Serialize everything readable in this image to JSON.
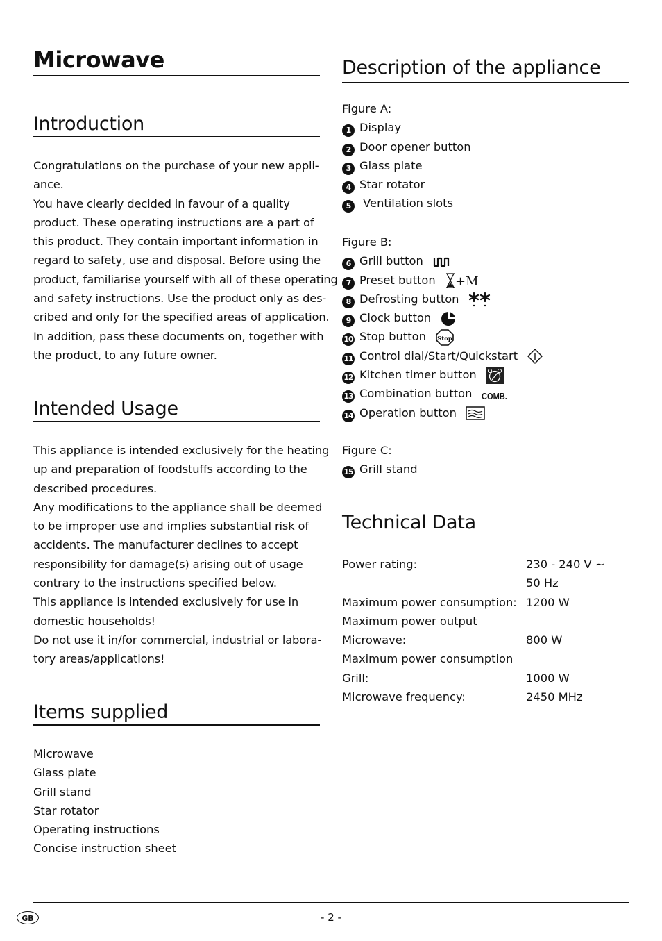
{
  "title": "Microwave",
  "introduction": {
    "heading": "Introduction",
    "lines": [
      "Congratulations on the purchase of your new appli-",
      "ance.",
      "You have clearly decided in favour of a quality",
      "product. These operating instructions are a part of",
      "this product. They contain important information in",
      "regard to safety, use and disposal. Before using the",
      "product, familiarise yourself with all of these operating",
      "and safety instructions. Use the product only as des-",
      "cribed and only for the specified areas of application.",
      "In addition, pass these documents on, together with",
      "the product, to any future owner."
    ]
  },
  "intended_usage": {
    "heading": "Intended Usage",
    "lines": [
      "This appliance is intended exclusively for the heating",
      "up and preparation of foodstuffs according to the",
      "described procedures.",
      "Any modifications to the appliance shall be deemed",
      "to be improper use and implies substantial risk of",
      "accidents. The manufacturer declines to accept",
      "responsibility for damage(s) arising out of usage",
      "contrary to the instructions specified below.",
      "This appliance is intended exclusively for use in",
      "domestic households!",
      "Do not use it in/for commercial, industrial or labora-",
      "tory areas/applications!"
    ]
  },
  "items_supplied": {
    "heading": "Items supplied",
    "items": [
      "Microwave",
      "Glass plate",
      "Grill stand",
      "Star rotator",
      "Operating instructions",
      "Concise instruction sheet"
    ]
  },
  "description": {
    "heading": "Description of the appliance",
    "figure_a": {
      "label": "Figure A:",
      "items": [
        {
          "num": "1",
          "text": "Display"
        },
        {
          "num": "2",
          "text": "Door opener button"
        },
        {
          "num": "3",
          "text": "Glass plate"
        },
        {
          "num": "4",
          "text": "Star rotator"
        },
        {
          "num": "5",
          "text": " Ventilation slots"
        }
      ]
    },
    "figure_b": {
      "label": "Figure B:",
      "items": [
        {
          "num": "6",
          "text": "Grill button",
          "icon": "grill-icon"
        },
        {
          "num": "7",
          "text": "Preset button",
          "icon": "hourglass-plus-m-icon"
        },
        {
          "num": "8",
          "text": "Defrosting button",
          "icon": "snowflake-icon"
        },
        {
          "num": "9",
          "text": "Clock button",
          "icon": "clock-icon"
        },
        {
          "num": "10",
          "text": "Stop button",
          "icon": "stop-icon",
          "icon_text": "Stop"
        },
        {
          "num": "11",
          "text": "Control dial/Start/Quickstart",
          "icon": "diamond-start-icon"
        },
        {
          "num": "12",
          "text": "Kitchen timer button",
          "icon": "alarm-clock-icon"
        },
        {
          "num": "13",
          "text": "Combination button",
          "icon": "comb-icon",
          "icon_text": "COMB."
        },
        {
          "num": "14",
          "text": "Operation button",
          "icon": "microwave-waves-icon"
        }
      ]
    },
    "figure_c": {
      "label": "Figure C:",
      "items": [
        {
          "num": "15",
          "text": "Grill stand"
        }
      ]
    }
  },
  "technical_data": {
    "heading": "Technical Data",
    "rows": [
      {
        "key": "Power rating:",
        "value": "230 - 240 V ~"
      },
      {
        "key": "",
        "value": "50 Hz"
      },
      {
        "key": "Maximum power consumption:",
        "value": "1200 W"
      },
      {
        "key": "Maximum power output",
        "value": ""
      },
      {
        "key": "Microwave:",
        "value": "800 W"
      },
      {
        "key": "Maximum power consumption",
        "value": ""
      },
      {
        "key": "Grill:",
        "value": "1000 W"
      },
      {
        "key": "Microwave frequency:",
        "value": "2450 MHz"
      }
    ]
  },
  "footer": {
    "country_badge": "GB",
    "page_number": "- 2 -"
  }
}
